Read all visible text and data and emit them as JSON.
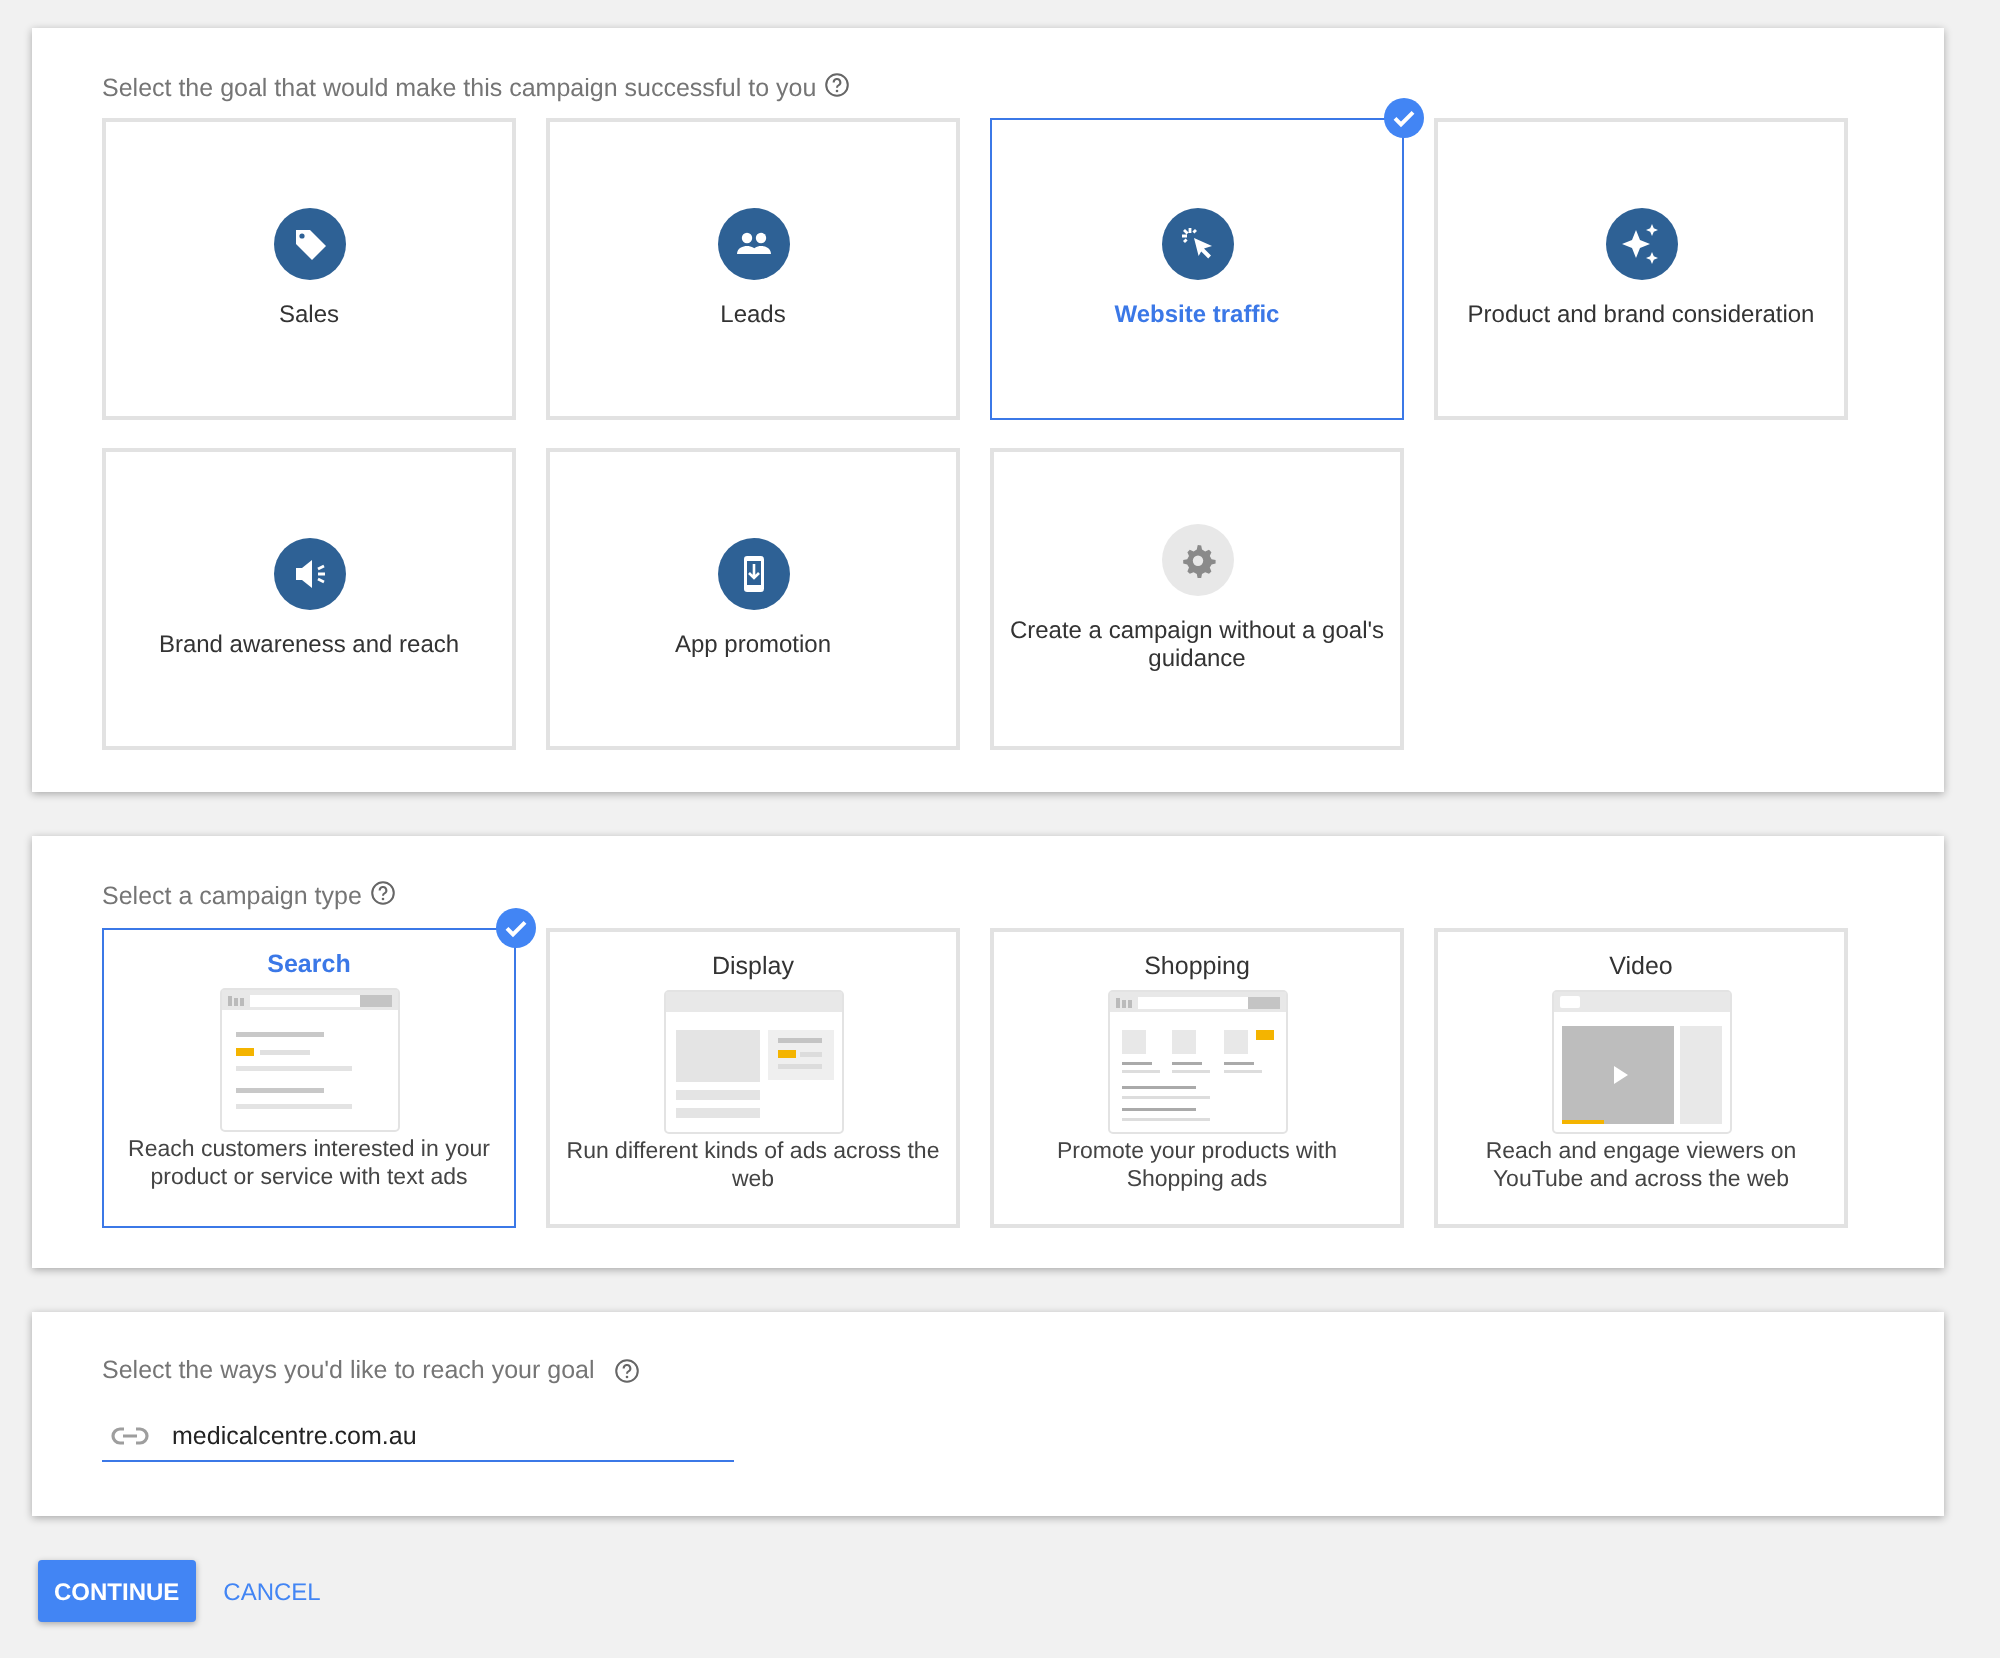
{
  "goal_section": {
    "heading": "Select the goal that would make this campaign successful to you",
    "goals": [
      {
        "label": "Sales",
        "kind": "tag",
        "selected": false
      },
      {
        "label": "Leads",
        "kind": "people",
        "selected": false
      },
      {
        "label": "Website traffic",
        "kind": "cursor",
        "selected": true
      },
      {
        "label": "Product and brand consideration",
        "kind": "sparkle",
        "selected": false
      },
      {
        "label": "Brand awareness and reach",
        "kind": "megaphone",
        "selected": false
      },
      {
        "label": "App promotion",
        "kind": "phone",
        "selected": false
      },
      {
        "label": "Create a campaign without a goal's guidance",
        "kind": "gear",
        "selected": false
      }
    ]
  },
  "type_section": {
    "heading": "Select a campaign type",
    "types": [
      {
        "name": "Search",
        "description": "Reach customers interested in your product or service with text ads",
        "kind": "search",
        "selected": true
      },
      {
        "name": "Display",
        "description": "Run different kinds of ads across the web",
        "kind": "display",
        "selected": false
      },
      {
        "name": "Shopping",
        "description": "Promote your products with Shopping ads",
        "kind": "shopping",
        "selected": false
      },
      {
        "name": "Video",
        "description": "Reach and engage viewers on YouTube and across the web",
        "kind": "video",
        "selected": false
      }
    ]
  },
  "reach_section": {
    "heading": "Select the ways you'd like to reach your goal",
    "url_field": {
      "value": "medicalcentre.com.au"
    }
  },
  "buttons": [
    {
      "label": "CONTINUE",
      "kind": "primary"
    },
    {
      "label": "CANCEL",
      "kind": "text"
    }
  ]
}
